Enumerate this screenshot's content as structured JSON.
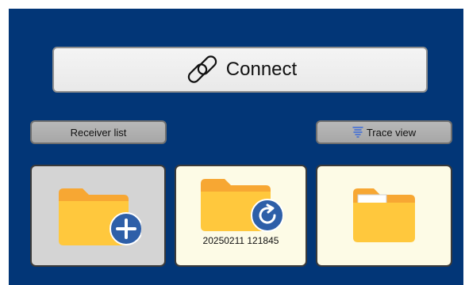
{
  "connect": {
    "label": "Connect",
    "icon": "link-icon"
  },
  "toolbar": {
    "receiver_list_label": "Receiver list",
    "trace_view_label": "Trace view",
    "trace_view_icon": "signal-icon"
  },
  "tiles": [
    {
      "id": "new",
      "icon": "folder-add-icon",
      "caption": ""
    },
    {
      "id": "recent",
      "icon": "folder-sync-icon",
      "caption": "20250211 121845"
    },
    {
      "id": "open",
      "icon": "folder-open-icon",
      "caption": ""
    }
  ],
  "colors": {
    "background": "#023677",
    "folder": "#FFC83D",
    "folder_tab": "#F7A733",
    "badge": "#2E5FA8",
    "tile_light": "#FDFBE6",
    "tile_gray": "#D4D4D4"
  }
}
